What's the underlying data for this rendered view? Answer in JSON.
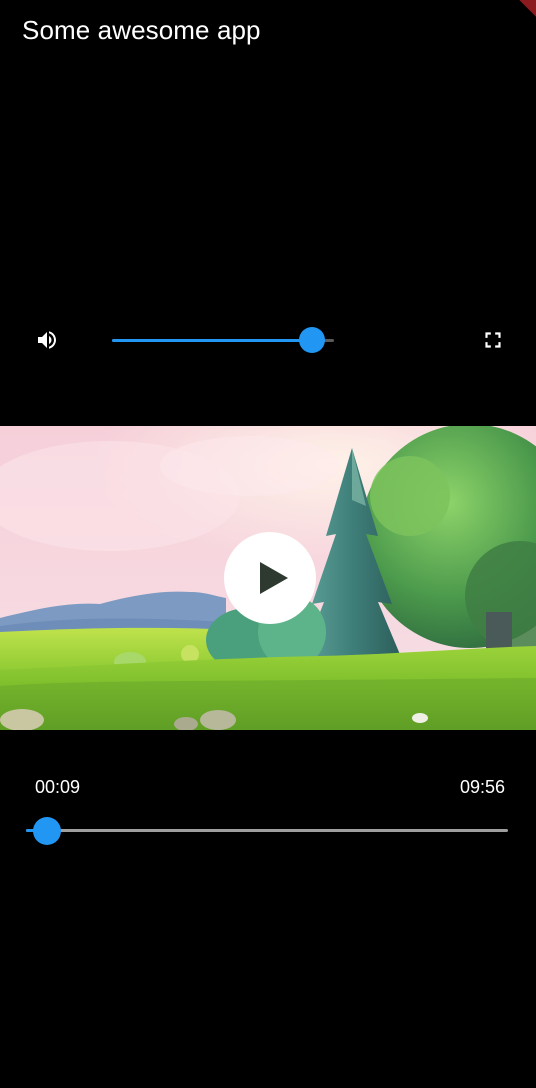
{
  "app": {
    "title": "Some awesome app"
  },
  "controls": {
    "volume": {
      "icon": "volume-up-icon",
      "level": 0.9
    },
    "fullscreen": {
      "icon": "fullscreen-icon"
    },
    "play": {
      "icon": "play-icon"
    }
  },
  "playback": {
    "current_time": "00:09",
    "total_time": "09:56",
    "progress": 0.015
  },
  "colors": {
    "accent": "#2196f3",
    "background": "#000000",
    "text": "#ffffff",
    "inactive_track": "#9e9e9e"
  }
}
